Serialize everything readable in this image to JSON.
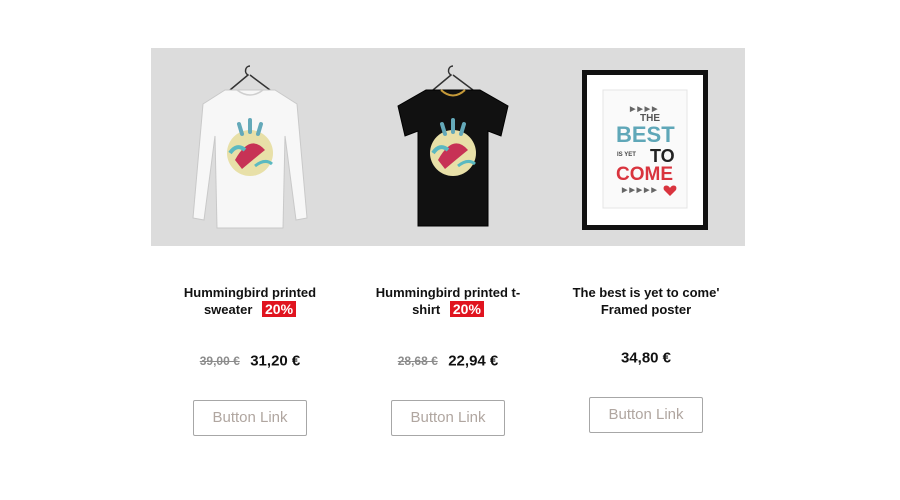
{
  "products": [
    {
      "name_line1": "Hummingbird printed",
      "name_line2": "sweater",
      "discount": "20%",
      "old_price": "39,00 €",
      "price": "31,20 €",
      "button_label": "Button Link",
      "image_icon": "white-long-sleeve-sweater-icon"
    },
    {
      "name_line1": "Hummingbird printed t-",
      "name_line2": "shirt",
      "discount": "20%",
      "old_price": "28,68 €",
      "price": "22,94 €",
      "button_label": "Button Link",
      "image_icon": "black-tshirt-icon"
    },
    {
      "name_line1": "The best is yet to come'",
      "name_line2": "Framed poster",
      "price": "34,80 €",
      "button_label": "Button Link",
      "image_icon": "framed-poster-icon",
      "poster_text": {
        "the": "THE",
        "best": "BEST",
        "is_yet": "IS YET",
        "to": "TO",
        "come": "COME"
      }
    }
  ],
  "colors": {
    "banner_bg": "#dcdcdc",
    "badge": "#e0141f",
    "button_text": "#b0a6a0",
    "button_border": "#a7a7a7",
    "poster_teal": "#5fa7b8",
    "poster_red": "#d9343e"
  }
}
